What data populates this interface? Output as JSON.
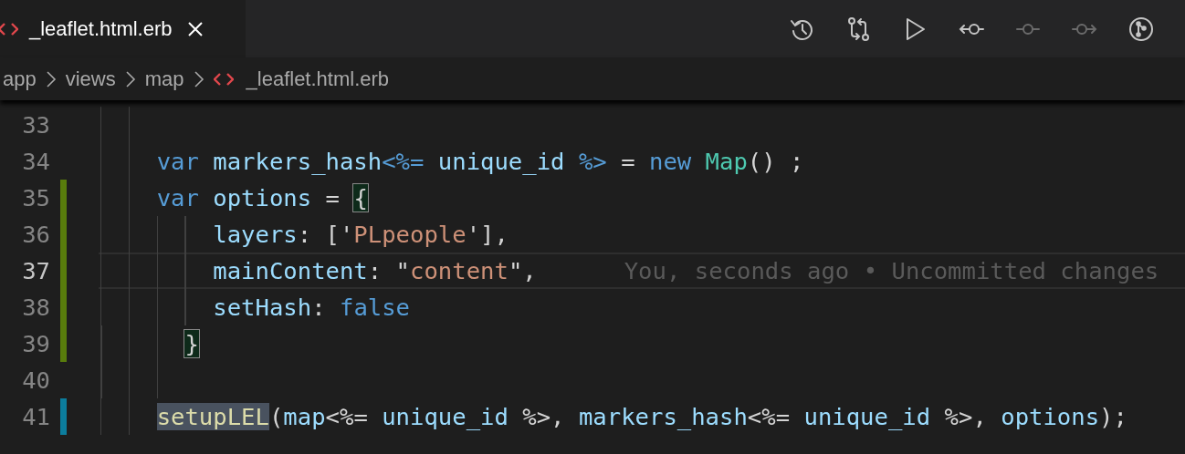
{
  "tab": {
    "label": "_leaflet.html.erb",
    "selected": true
  },
  "toolbar": [
    {
      "kind": "history",
      "disabled": false
    },
    {
      "kind": "compare",
      "disabled": false
    },
    {
      "kind": "run",
      "disabled": false
    },
    {
      "kind": "commit-previous",
      "disabled": false
    },
    {
      "kind": "commit",
      "disabled": true
    },
    {
      "kind": "commit-next",
      "disabled": true
    },
    {
      "kind": "branch-graph",
      "disabled": false
    }
  ],
  "breadcrumbs": [
    {
      "label": "app",
      "kind": "folder"
    },
    {
      "label": "views",
      "kind": "folder"
    },
    {
      "label": "map",
      "kind": "folder"
    },
    {
      "label": "_leaflet.html.erb",
      "kind": "file"
    }
  ],
  "lines": [
    {
      "number": "33",
      "added": false,
      "modified": false,
      "current": false
    },
    {
      "number": "34",
      "added": false,
      "modified": false,
      "current": false,
      "tokens": [
        {
          "kind": "keyword",
          "text": "    var "
        },
        {
          "kind": "ident",
          "text": "markers_hash"
        },
        {
          "kind": "tag",
          "text": "<%= "
        },
        {
          "kind": "ident",
          "text": "unique_id "
        },
        {
          "kind": "tag",
          "text": "%>"
        },
        {
          "kind": "op",
          "text": " = "
        },
        {
          "kind": "keyword",
          "text": "new "
        },
        {
          "kind": "type",
          "text": "Map"
        },
        {
          "kind": "op",
          "text": "() ;"
        }
      ]
    },
    {
      "number": "35",
      "added": true,
      "modified": false,
      "current": false,
      "tokens": [
        {
          "kind": "keyword",
          "text": "    var "
        },
        {
          "kind": "ident",
          "text": "options"
        },
        {
          "kind": "op",
          "text": " = "
        },
        {
          "kind": "bracket-match",
          "text": "{"
        }
      ]
    },
    {
      "number": "36",
      "added": true,
      "modified": false,
      "current": false,
      "tokens": [
        {
          "kind": "ident",
          "text": "        layers"
        },
        {
          "kind": "op",
          "text": ": ['"
        },
        {
          "kind": "string",
          "text": "PLpeople"
        },
        {
          "kind": "op",
          "text": "'],"
        }
      ]
    },
    {
      "number": "37",
      "added": true,
      "modified": false,
      "current": true,
      "tokens": [
        {
          "kind": "ident",
          "text": "        mainContent"
        },
        {
          "kind": "op",
          "text": ": \""
        },
        {
          "kind": "string",
          "text": "content"
        },
        {
          "kind": "op",
          "text": "\","
        }
      ],
      "blame": "You, seconds ago • Uncommitted changes"
    },
    {
      "number": "38",
      "added": true,
      "modified": false,
      "current": false,
      "tokens": [
        {
          "kind": "ident",
          "text": "        setHash"
        },
        {
          "kind": "op",
          "text": ": "
        },
        {
          "kind": "keyword",
          "text": "false"
        }
      ]
    },
    {
      "number": "39",
      "added": true,
      "modified": false,
      "current": false,
      "tokens": [
        {
          "kind": "bracket-match",
          "text": "      }"
        }
      ]
    },
    {
      "number": "40",
      "added": false,
      "modified": false,
      "current": false
    },
    {
      "number": "41",
      "added": false,
      "modified": true,
      "current": false,
      "tokens": [
        {
          "kind": "func-highlight",
          "text": "    setupLEL"
        },
        {
          "kind": "op",
          "text": "("
        },
        {
          "kind": "ident",
          "text": "map"
        },
        {
          "kind": "op",
          "text": "<%= "
        },
        {
          "kind": "ident",
          "text": "unique_id"
        },
        {
          "kind": "op",
          "text": " %>, "
        },
        {
          "kind": "ident",
          "text": "markers_hash"
        },
        {
          "kind": "op",
          "text": "<%= "
        },
        {
          "kind": "ident",
          "text": "unique_id"
        },
        {
          "kind": "op",
          "text": " %>, "
        },
        {
          "kind": "ident",
          "text": "options"
        },
        {
          "kind": "op",
          "text": ");"
        }
      ]
    }
  ]
}
